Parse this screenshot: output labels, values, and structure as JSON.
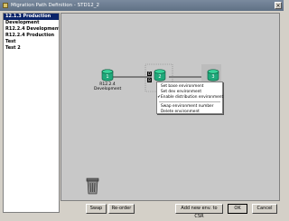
{
  "window": {
    "title": "Migration Path Definition - STD12_2",
    "close_label": "×"
  },
  "list": {
    "items": [
      {
        "label": "12.1.3 Production",
        "selected": true
      },
      {
        "label": "Development",
        "selected": false
      },
      {
        "label": "R12.2.4 Development",
        "selected": false
      },
      {
        "label": "R12.2.4 Production",
        "selected": false
      },
      {
        "label": "Test",
        "selected": false
      },
      {
        "label": "Test 2",
        "selected": false
      }
    ]
  },
  "canvas": {
    "nodes": [
      {
        "number": "1",
        "label_line1": "R12.2.4",
        "label_line2": "Development"
      },
      {
        "number": "2",
        "label_line1": "Tes",
        "label_line2": ""
      },
      {
        "number": "3",
        "label_line1": "",
        "label_line2": ""
      }
    ],
    "context_menu": [
      {
        "label": "Set base environment",
        "checked": false
      },
      {
        "label": "Set dev environment",
        "checked": false
      },
      {
        "label": "Enable distribution environment",
        "checked": true
      },
      {
        "label": "Swap environment number",
        "checked": false
      },
      {
        "label": "Delete environment",
        "checked": false
      }
    ],
    "check_glyph": "✔"
  },
  "buttons": {
    "swap": "Swap",
    "reorder": "Re-order",
    "add_new": "Add new env. to CSR",
    "ok": "OK",
    "cancel": "Cancel"
  },
  "colors": {
    "node_fill": "#1fa87a",
    "selection": "#0a246a"
  }
}
